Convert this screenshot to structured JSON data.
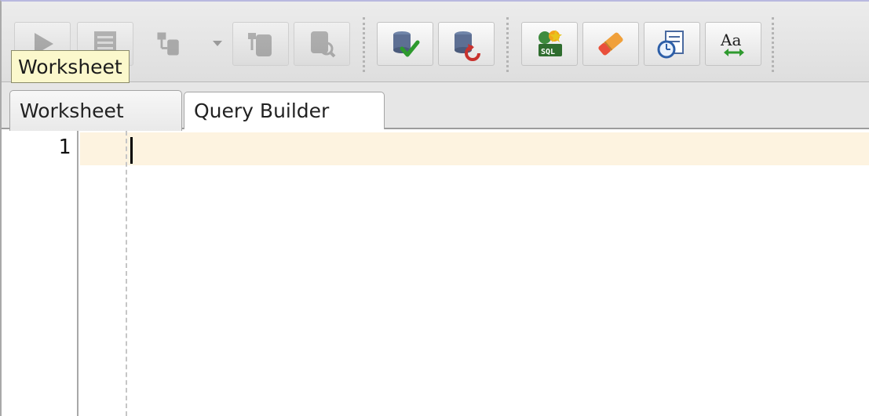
{
  "tooltip": {
    "text": "Worksheet"
  },
  "toolbar": {
    "buttons": [
      {
        "icon": "run-statement-icon",
        "enabled": false
      },
      {
        "icon": "run-script-icon",
        "enabled": false
      },
      {
        "icon": "explain-plan-icon",
        "enabled": false
      },
      {
        "icon": "autotrace-icon",
        "enabled": false
      },
      {
        "icon": "sql-tuning-advisor-icon",
        "enabled": false
      },
      {
        "icon": "commit-icon",
        "enabled": true
      },
      {
        "icon": "rollback-icon",
        "enabled": true
      },
      {
        "icon": "unshared-sql-worksheet-icon",
        "enabled": true
      },
      {
        "icon": "clear-icon",
        "enabled": true
      },
      {
        "icon": "sql-history-icon",
        "enabled": true
      },
      {
        "icon": "change-case-icon",
        "enabled": true
      }
    ]
  },
  "tabs": [
    {
      "label": "Worksheet",
      "active": true
    },
    {
      "label": "Query Builder",
      "active": false
    }
  ],
  "editor": {
    "line_numbers": [
      "1"
    ],
    "content": "",
    "current_line_color": "#fdf3e0"
  }
}
